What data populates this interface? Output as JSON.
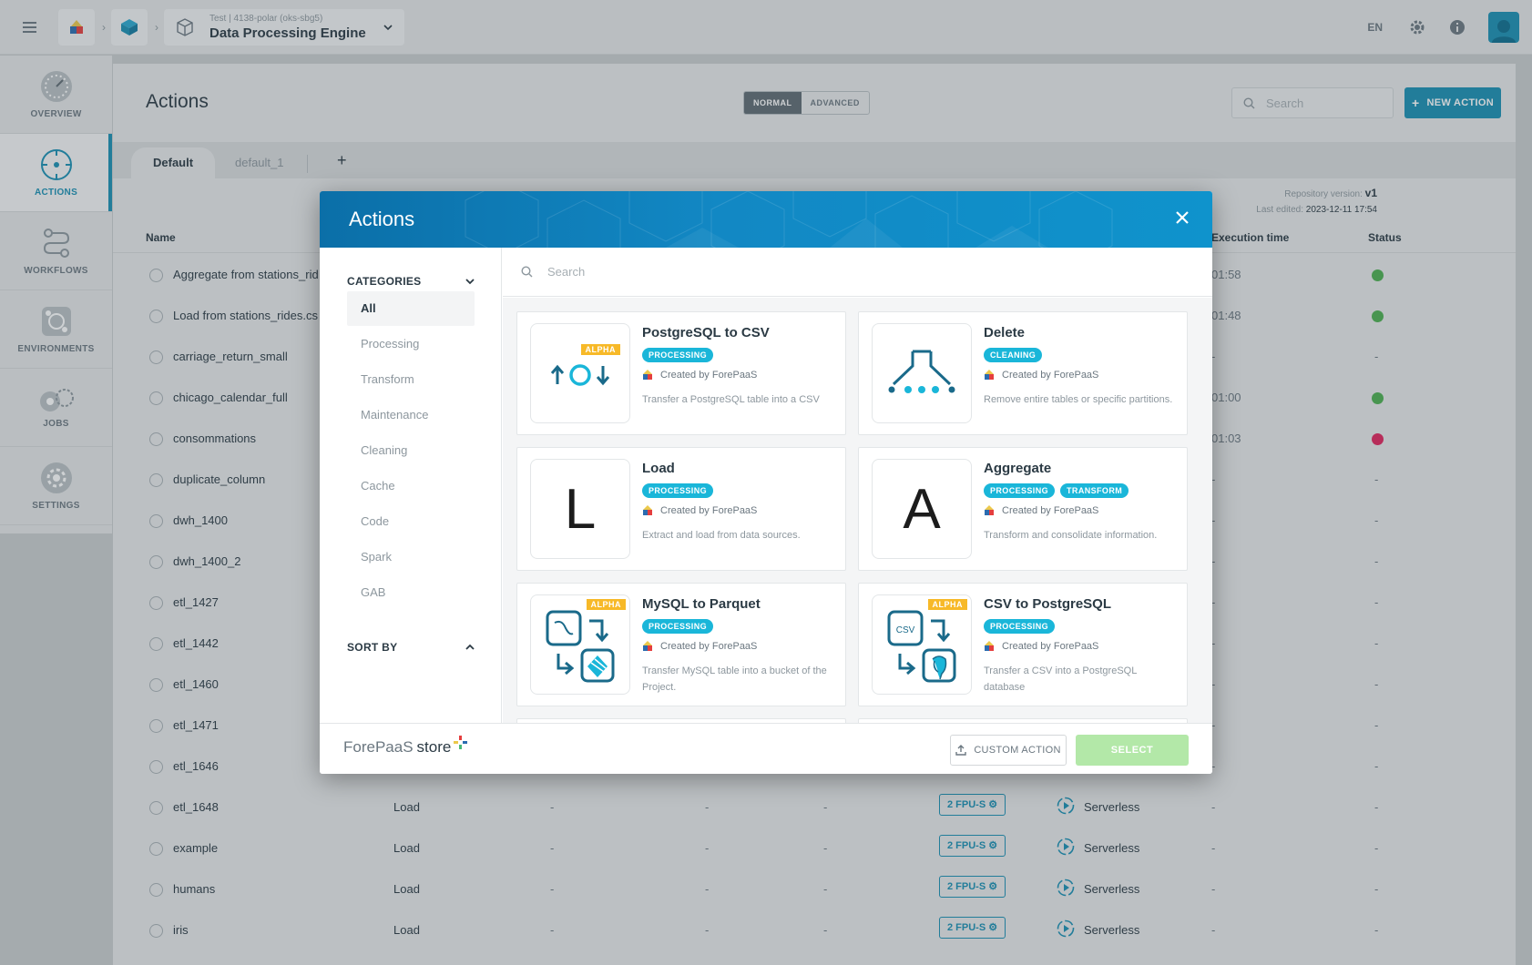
{
  "topbar": {
    "project_sub": "Test | 4138-polar (oks-sbg5)",
    "project_title": "Data Processing Engine",
    "language": "EN"
  },
  "sidebar": {
    "items": [
      {
        "label": "OVERVIEW",
        "icon": "speedometer-icon"
      },
      {
        "label": "ACTIONS",
        "icon": "target-icon"
      },
      {
        "label": "WORKFLOWS",
        "icon": "workflow-icon"
      },
      {
        "label": "ENVIRONMENTS",
        "icon": "environment-icon"
      },
      {
        "label": "JOBS",
        "icon": "jobs-icon"
      },
      {
        "label": "SETTINGS",
        "icon": "settings-icon"
      }
    ]
  },
  "main": {
    "title": "Actions",
    "mode_normal": "NORMAL",
    "mode_advanced": "ADVANCED",
    "search_placeholder": "Search",
    "new_action": "NEW ACTION",
    "tabs": [
      "Default",
      "default_1"
    ],
    "repo_version_label": "Repository version:",
    "repo_version": "v1",
    "last_edited_label": "Last edited:",
    "last_edited": "2023-12-11 17:54",
    "columns": {
      "name": "Name",
      "execution_time": "Execution time",
      "status": "Status"
    },
    "rows": [
      {
        "name": "Aggregate from stations_rid",
        "exec": "01:58",
        "status": "ok"
      },
      {
        "name": "Load from stations_rides.cs",
        "exec": "01:48",
        "status": "ok"
      },
      {
        "name": "carriage_return_small",
        "exec": "-",
        "status": "-"
      },
      {
        "name": "chicago_calendar_full",
        "exec": "01:00",
        "status": "ok"
      },
      {
        "name": "consommations",
        "exec": "01:03",
        "status": "err"
      },
      {
        "name": "duplicate_column",
        "exec": "-",
        "status": "-"
      },
      {
        "name": "dwh_1400",
        "exec": "-",
        "status": "-"
      },
      {
        "name": "dwh_1400_2",
        "exec": "-",
        "status": "-"
      },
      {
        "name": "etl_1427",
        "exec": "-",
        "status": "-"
      },
      {
        "name": "etl_1442",
        "exec": "-",
        "status": "-"
      },
      {
        "name": "etl_1460",
        "exec": "-",
        "status": "-"
      },
      {
        "name": "etl_1471",
        "exec": "-",
        "status": "-"
      },
      {
        "name": "etl_1646",
        "exec": "-",
        "status": "-"
      },
      {
        "name": "etl_1648",
        "type": "Load",
        "fpu": "2 FPU-S",
        "env": "Serverless",
        "exec": "-",
        "status": "-"
      },
      {
        "name": "example",
        "type": "Load",
        "fpu": "2 FPU-S",
        "env": "Serverless",
        "exec": "-",
        "status": "-"
      },
      {
        "name": "humans",
        "type": "Load",
        "fpu": "2 FPU-S",
        "env": "Serverless",
        "exec": "-",
        "status": "-"
      },
      {
        "name": "iris",
        "type": "Load",
        "fpu": "2 FPU-S",
        "env": "Serverless",
        "exec": "-",
        "status": "-"
      }
    ]
  },
  "modal": {
    "title": "Actions",
    "categories_label": "CATEGORIES",
    "categories": [
      "All",
      "Processing",
      "Transform",
      "Maintenance",
      "Cleaning",
      "Cache",
      "Code",
      "Spark",
      "GAB"
    ],
    "sort_by_label": "SORT BY",
    "search_placeholder": "Search",
    "cards": [
      {
        "title": "PostgreSQL to CSV",
        "badges": [
          "PROCESSING"
        ],
        "alpha": "ALPHA",
        "creator": "Created by ForePaaS",
        "desc": "Transfer a PostgreSQL table into a CSV"
      },
      {
        "title": "Delete",
        "badges": [
          "CLEANING"
        ],
        "creator": "Created by ForePaaS",
        "desc": "Remove entire tables or specific partitions."
      },
      {
        "title": "Load",
        "badges": [
          "PROCESSING"
        ],
        "letter": "L",
        "creator": "Created by ForePaaS",
        "desc": "Extract and load from data sources."
      },
      {
        "title": "Aggregate",
        "badges": [
          "PROCESSING",
          "TRANSFORM"
        ],
        "letter": "A",
        "creator": "Created by ForePaaS",
        "desc": "Transform and consolidate information."
      },
      {
        "title": "MySQL to Parquet",
        "badges": [
          "PROCESSING"
        ],
        "alpha": "ALPHA",
        "creator": "Created by ForePaaS",
        "desc": "Transfer MySQL table into a bucket of the Project."
      },
      {
        "title": "CSV to PostgreSQL",
        "badges": [
          "PROCESSING"
        ],
        "alpha": "ALPHA",
        "thumb_text": "CSV",
        "creator": "Created by ForePaaS",
        "desc": "Transfer a CSV into a PostgreSQL database"
      }
    ],
    "brand": "ForePaaS",
    "brand_store": "store",
    "custom_action": "CUSTOM ACTION",
    "select": "SELECT"
  },
  "colors": {
    "accent": "#1a8fb3",
    "badge": "#1ab6d9",
    "alpha": "#f7b928",
    "select_disabled": "#b3e8a8"
  }
}
